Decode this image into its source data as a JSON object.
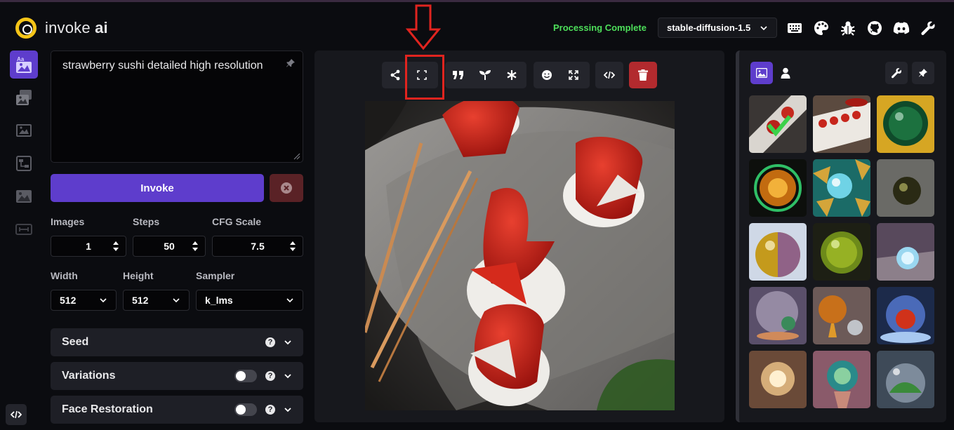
{
  "header": {
    "brand_light": "invoke",
    "brand_bold": "ai",
    "status": "Processing Complete",
    "model": "stable-diffusion-1.5",
    "icons": [
      "keyboard-icon",
      "palette-icon",
      "bug-icon",
      "github-icon",
      "discord-icon",
      "wrench-icon"
    ]
  },
  "nav": {
    "items": [
      "text-to-image-icon",
      "image-to-image-icon",
      "inpainting-icon",
      "nodes-icon",
      "outpainting-icon",
      "training-icon"
    ],
    "active": "text-to-image-icon"
  },
  "prompt": {
    "value": "strawberry sushi detailed high resolution"
  },
  "actions": {
    "invoke": "Invoke"
  },
  "params": {
    "images_label": "Images",
    "images": "1",
    "steps_label": "Steps",
    "steps": "50",
    "cfg_label": "CFG Scale",
    "cfg": "7.5",
    "width_label": "Width",
    "width": "512",
    "height_label": "Height",
    "height": "512",
    "sampler_label": "Sampler",
    "sampler": "k_lms"
  },
  "accordions": {
    "seed": "Seed",
    "variations": "Variations",
    "face_restoration": "Face Restoration"
  },
  "toolbar": {
    "groups": [
      [
        "share-icon",
        "fullscreen-icon"
      ],
      [
        "quote-icon",
        "seedling-icon",
        "asterisk-icon"
      ],
      [
        "face-icon",
        "expand-icon"
      ],
      [
        "code-icon"
      ]
    ],
    "delete": "trash-icon"
  },
  "gallery": {
    "tabs": [
      "image-tab-icon",
      "user-tab-icon"
    ],
    "tools": [
      "wrench-icon",
      "pin-icon"
    ],
    "colors": {
      "accent": "#5e3dcc",
      "status": "#4ddf5a",
      "danger": "#b22a2e",
      "annotation": "#e0241f"
    }
  }
}
